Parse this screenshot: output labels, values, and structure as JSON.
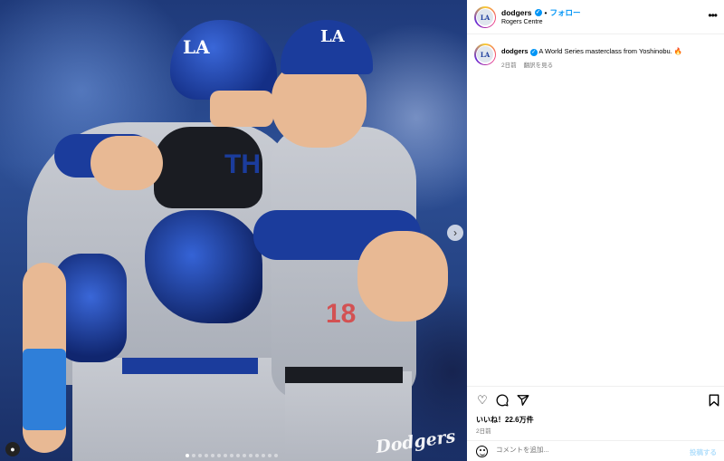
{
  "photo": {
    "watermark": "Dodgers",
    "helmet_logo": "LA",
    "cap_logo": "LA",
    "jersey_lettering": "TH",
    "jersey_number_fragment": "18",
    "carousel_total": 15,
    "carousel_active": 1
  },
  "post": {
    "username": "dodgers",
    "follow_separator": "•",
    "follow_label": "フォロー",
    "location": "Rogers Centre",
    "more_icon": "more-horizontal-icon",
    "caption_user": "dodgers",
    "caption_text": "A World Series masterclass from Yoshinobu. 🔥",
    "caption_age": "2日前",
    "translate_label": "翻訳を見る",
    "likes_text": "いいね！22.6万件",
    "post_age": "2日前",
    "comment_placeholder": "コメントを追加...",
    "post_button": "投稿する"
  },
  "colors": {
    "accent": "#0095f6",
    "dodger_blue": "#1b3c9c",
    "muted_text": "#737373"
  }
}
